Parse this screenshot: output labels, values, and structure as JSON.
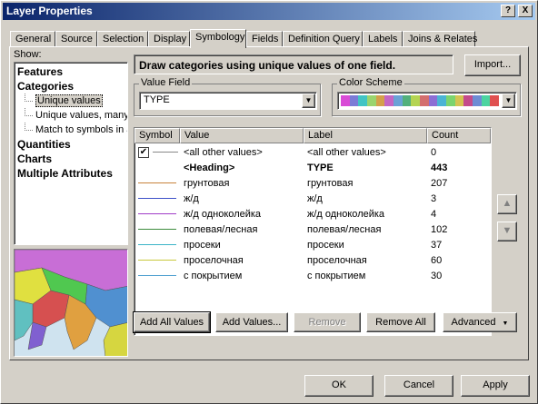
{
  "window": {
    "title": "Layer Properties",
    "help_glyph": "?",
    "close_glyph": "X"
  },
  "tabs": [
    "General",
    "Source",
    "Selection",
    "Display",
    "Symbology",
    "Fields",
    "Definition Query",
    "Labels",
    "Joins & Relates"
  ],
  "active_tab": "Symbology",
  "show": {
    "label": "Show:",
    "items": [
      {
        "label": "Features",
        "bold": true
      },
      {
        "label": "Categories",
        "bold": true
      },
      {
        "label": "Unique values",
        "bold": false,
        "selected": true
      },
      {
        "label": "Unique values, many fields",
        "bold": false
      },
      {
        "label": "Match to symbols in a style",
        "bold": false
      },
      {
        "label": "Quantities",
        "bold": true
      },
      {
        "label": "Charts",
        "bold": true
      },
      {
        "label": "Multiple Attributes",
        "bold": true
      }
    ]
  },
  "description": "Draw categories using unique values of one field.",
  "import_button": "Import...",
  "value_field": {
    "label": "Value Field",
    "value": "TYPE"
  },
  "color_scheme": {
    "label": "Color Scheme",
    "colors": [
      "#d94bd6",
      "#7b7bd6",
      "#41c4c4",
      "#9ad46e",
      "#d4a04b",
      "#c467c4",
      "#6aa2d6",
      "#52b07c",
      "#b4d452",
      "#d46e6e",
      "#8c6ed4",
      "#4bb4d4",
      "#7cd46e",
      "#d4c452",
      "#c44b8c",
      "#6e8cd4",
      "#4bd4a0",
      "#e05050"
    ]
  },
  "table": {
    "headers": [
      "Symbol",
      "Value",
      "Label",
      "Count"
    ],
    "rows": [
      {
        "checked": true,
        "color": "#888888",
        "value": "<all other values>",
        "label": "<all other values>",
        "count": "0",
        "bold": false
      },
      {
        "color": "",
        "value": "<Heading>",
        "label": "TYPE",
        "count": "443",
        "bold": true
      },
      {
        "color": "#c8823c",
        "value": "грунтовая",
        "label": "грунтовая",
        "count": "207",
        "bold": false
      },
      {
        "color": "#3c50c8",
        "value": "ж/д",
        "label": "ж/д",
        "count": "3",
        "bold": false
      },
      {
        "color": "#a03cc8",
        "value": "ж/д одноколейка",
        "label": "ж/д одноколейка",
        "count": "4",
        "bold": false
      },
      {
        "color": "#3c8c3c",
        "value": "полевая/лесная",
        "label": "полевая/лесная",
        "count": "102",
        "bold": false
      },
      {
        "color": "#3cb4c8",
        "value": "просеки",
        "label": "просеки",
        "count": "37",
        "bold": false
      },
      {
        "color": "#c8c83c",
        "value": "проселочная",
        "label": "проселочная",
        "count": "60",
        "bold": false
      },
      {
        "color": "#50a0d0",
        "value": "с покрытием",
        "label": "с покрытием",
        "count": "30",
        "bold": false
      }
    ]
  },
  "move_up_glyph": "▲",
  "move_down_glyph": "▼",
  "buttons": {
    "add_all": "Add All Values",
    "add": "Add Values...",
    "remove": "Remove",
    "remove_all": "Remove All",
    "advanced": "Advanced",
    "ok": "OK",
    "cancel": "Cancel",
    "apply": "Apply"
  }
}
